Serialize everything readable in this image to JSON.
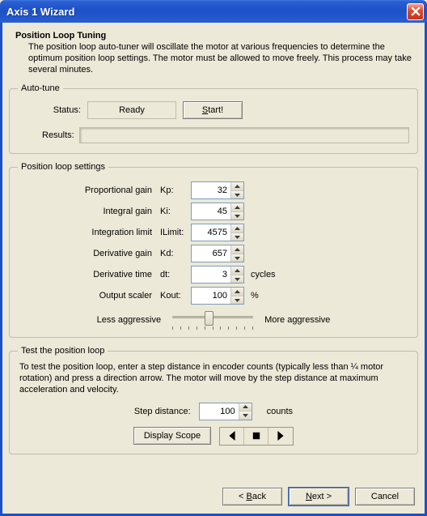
{
  "window": {
    "title": "Axis 1 Wizard"
  },
  "header": {
    "title": "Position Loop Tuning",
    "intro": "The position loop auto-tuner will oscillate the motor at various frequencies to determine the optimum position loop settings. The motor must be allowed to move freely. This process may take several minutes."
  },
  "autotune": {
    "legend": "Auto-tune",
    "status_label": "Status:",
    "status_value": "Ready",
    "start_label": "Start!",
    "results_label": "Results:",
    "results_value": ""
  },
  "settings": {
    "legend": "Position loop settings",
    "rows": [
      {
        "label": "Proportional gain",
        "symbol": "Kp:",
        "value": "32",
        "suffix": ""
      },
      {
        "label": "Integral gain",
        "symbol": "Ki:",
        "value": "45",
        "suffix": ""
      },
      {
        "label": "Integration limit",
        "symbol": "ILimit:",
        "value": "4575",
        "suffix": ""
      },
      {
        "label": "Derivative gain",
        "symbol": "Kd:",
        "value": "657",
        "suffix": ""
      },
      {
        "label": "Derivative time",
        "symbol": "dt:",
        "value": "3",
        "suffix": "cycles"
      },
      {
        "label": "Output scaler",
        "symbol": "Kout:",
        "value": "100",
        "suffix": "%"
      }
    ],
    "slider": {
      "less": "Less aggressive",
      "more": "More aggressive"
    }
  },
  "test": {
    "legend": "Test the position loop",
    "text": "To test the position loop, enter a step distance in encoder counts (typically less than ¼ motor rotation) and press a direction arrow. The motor will move by the step distance at maximum acceleration and velocity.",
    "step_label": "Step distance:",
    "step_value": "100",
    "step_suffix": "counts",
    "scope_label": "Display Scope"
  },
  "footer": {
    "back": "< Back",
    "next": "Next >",
    "cancel": "Cancel"
  }
}
